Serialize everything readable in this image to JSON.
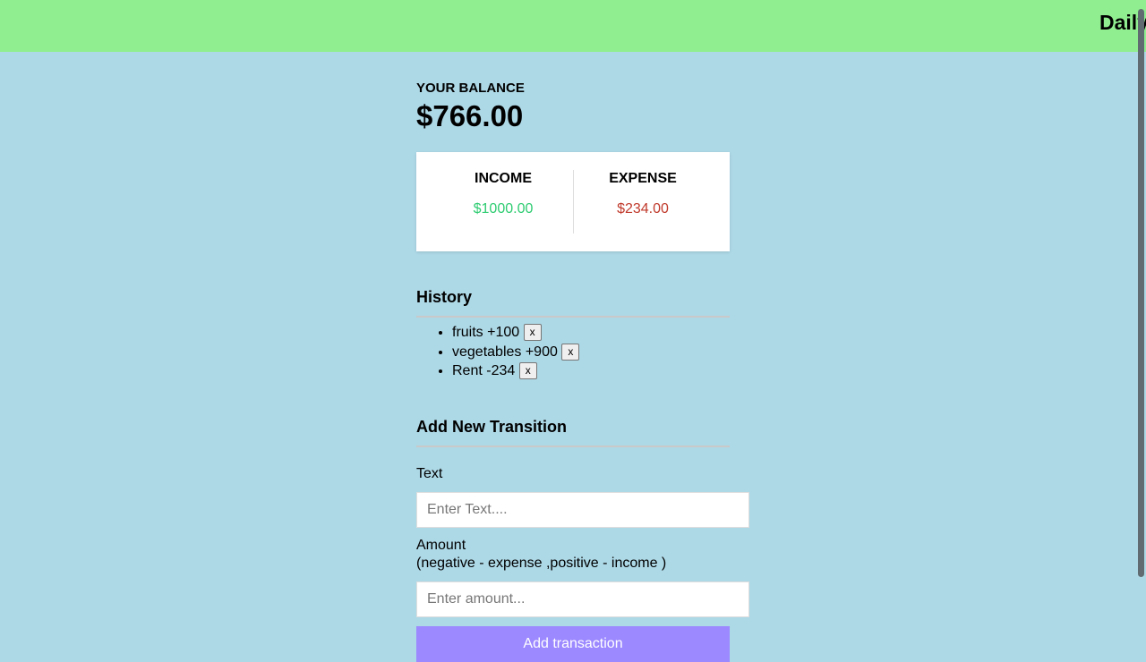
{
  "header": {
    "title": "Daily"
  },
  "balance": {
    "label": "YOUR BALANCE",
    "amount": "$766.00"
  },
  "summary": {
    "income_label": "INCOME",
    "income_value": "$1000.00",
    "expense_label": "EXPENSE",
    "expense_value": "$234.00"
  },
  "history": {
    "title": "History",
    "items": [
      {
        "text": "fruits +100",
        "delete_label": "x"
      },
      {
        "text": "vegetables +900",
        "delete_label": "x"
      },
      {
        "text": "Rent -234",
        "delete_label": "x"
      }
    ]
  },
  "form": {
    "title": "Add New Transition",
    "text_label": "Text",
    "text_placeholder": "Enter Text....",
    "text_value": "",
    "amount_label": "Amount",
    "amount_hint": "(negative - expense ,positive - income )",
    "amount_placeholder": "Enter amount...",
    "amount_value": "",
    "submit_label": "Add transaction"
  },
  "colors": {
    "header_bg": "#90ee90",
    "page_bg": "#add8e6",
    "income": "#2ecc71",
    "expense": "#c0392b",
    "submit_bg": "#9c88ff"
  }
}
